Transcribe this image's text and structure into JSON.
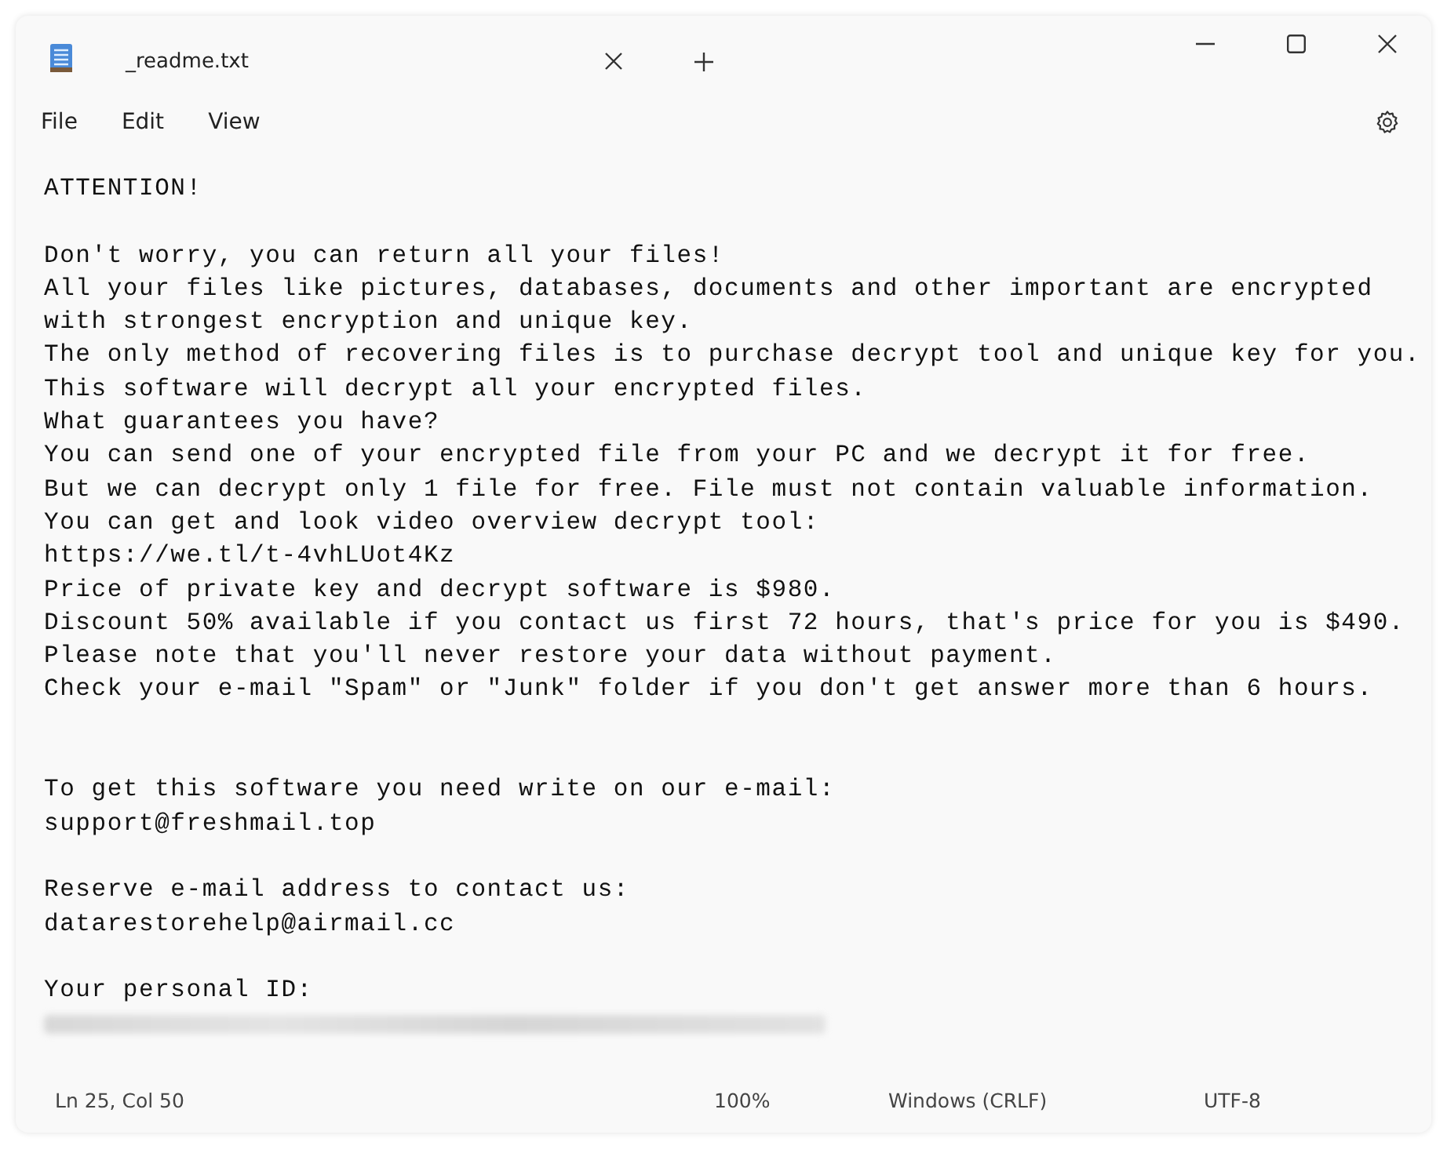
{
  "window": {
    "tab_title": "_readme.txt"
  },
  "menu": [
    {
      "label": "File"
    },
    {
      "label": "Edit"
    },
    {
      "label": "View"
    }
  ],
  "lines": [
    {
      "kind": "text",
      "text": "ATTENTION!"
    },
    {
      "kind": "blank"
    },
    {
      "kind": "text",
      "text": "Don't worry, you can return all your files!"
    },
    {
      "kind": "text",
      "text": "All your files like pictures, databases, documents and other important are encrypted"
    },
    {
      "kind": "text",
      "text": "with strongest encryption and unique key."
    },
    {
      "kind": "text",
      "text": "The only method of recovering files is to purchase decrypt tool and unique key for you."
    },
    {
      "kind": "text",
      "text": "This software will decrypt all your encrypted files."
    },
    {
      "kind": "text",
      "text": "What guarantees you have?"
    },
    {
      "kind": "text",
      "text": "You can send one of your encrypted file from your PC and we decrypt it for free."
    },
    {
      "kind": "text",
      "text": "But we can decrypt only 1 file for free. File must not contain valuable information."
    },
    {
      "kind": "text",
      "text": "You can get and look video overview decrypt tool:"
    },
    {
      "kind": "text",
      "text": "https://we.tl/t-4vhLUot4Kz"
    },
    {
      "kind": "text",
      "text": "Price of private key and decrypt software is $980."
    },
    {
      "kind": "text",
      "text": "Discount 50% available if you contact us first 72 hours, that's price for you is $490."
    },
    {
      "kind": "text",
      "text": "Please note that you'll never restore your data without payment."
    },
    {
      "kind": "text",
      "text": "Check your e-mail \"Spam\" or \"Junk\" folder if you don't get answer more than 6 hours."
    },
    {
      "kind": "blank"
    },
    {
      "kind": "blank"
    },
    {
      "kind": "text",
      "text": "To get this software you need write on our e-mail:"
    },
    {
      "kind": "text",
      "text": "support@freshmail.top"
    },
    {
      "kind": "blank"
    },
    {
      "kind": "text",
      "text": "Reserve e-mail address to contact us:"
    },
    {
      "kind": "text",
      "text": "datarestorehelp@airmail.cc"
    },
    {
      "kind": "blank"
    },
    {
      "kind": "text",
      "text": "Your personal ID:"
    },
    {
      "kind": "redacted"
    }
  ],
  "status_bar": {
    "position": "Ln 25, Col 50",
    "zoom": "100%",
    "line_endings": "Windows (CRLF)",
    "encoding": "UTF-8"
  }
}
